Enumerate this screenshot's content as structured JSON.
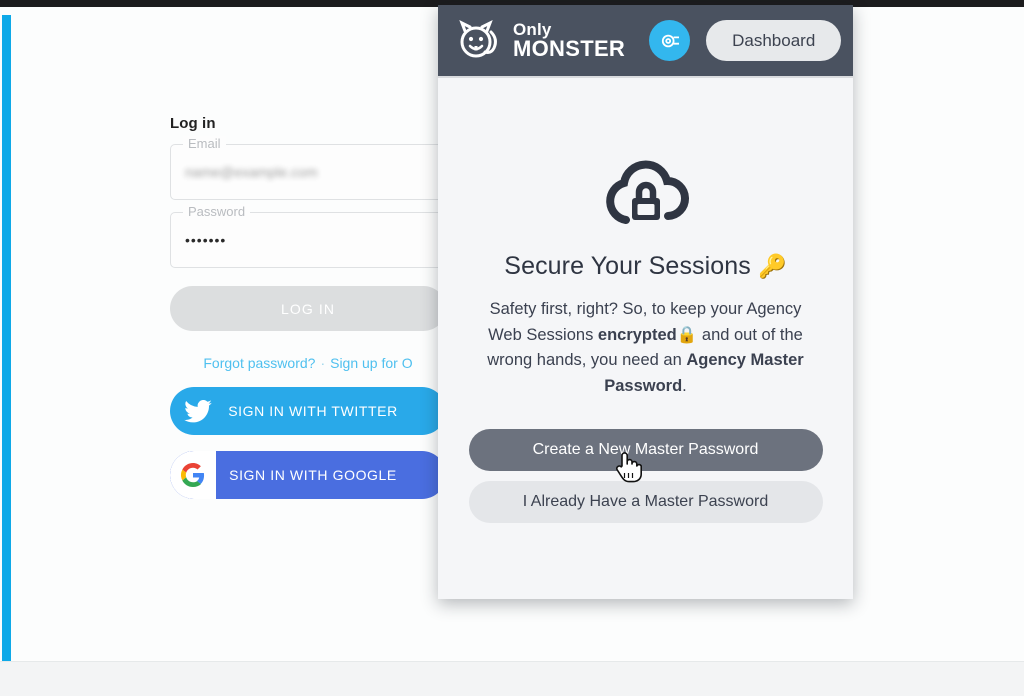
{
  "colors": {
    "accent_blue": "#0ea9e8",
    "header_dark": "#4a5260",
    "twitter_blue": "#29a9e9",
    "google_blue": "#4a6ee0",
    "primary_button": "#6c727e",
    "secondary_button": "#e4e6e9",
    "link_blue": "#4fc0ef"
  },
  "login": {
    "title": "Log in",
    "email": {
      "label": "Email",
      "value": "",
      "placeholder": "Email"
    },
    "password": {
      "label": "Password",
      "value": "•••••••",
      "placeholder": "Password"
    },
    "submit_label": "LOG IN",
    "links": {
      "forgot": "Forgot password?",
      "separator": "·",
      "signup": "Sign up for O"
    },
    "social": [
      {
        "label": "SIGN IN WITH TWITTER",
        "icon": "twitter-icon"
      },
      {
        "label": "SIGN IN WITH GOOGLE",
        "icon": "google-icon"
      }
    ]
  },
  "panel": {
    "header": {
      "logo_line1": "Only",
      "logo_line2": "MONSTER",
      "logo_icon": "monster-face-icon",
      "badge_icon": "camera-eye-icon",
      "dashboard_label": "Dashboard"
    },
    "hero_icon": "cloud-lock-icon",
    "title": "Secure Your Sessions",
    "title_emoji": "🔑",
    "body": {
      "part1": "Safety first, right? So, to keep your Agency Web Sessions ",
      "bold1": "encrypted",
      "emoji1": "🔒",
      "part2": " and out of the wrong hands, you need an ",
      "bold2": "Agency Master Password",
      "part3": "."
    },
    "buttons": {
      "primary": "Create a New Master Password",
      "secondary": "I Already Have a Master Password"
    }
  },
  "cursor": {
    "type": "pointing-hand-cursor"
  }
}
